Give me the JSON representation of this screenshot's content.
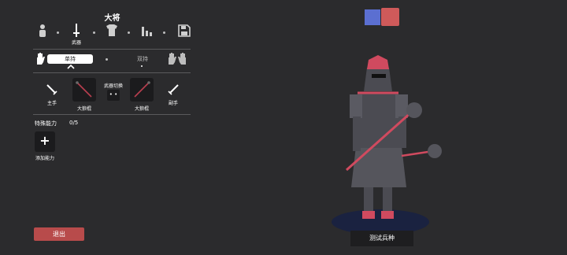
{
  "title": "大将",
  "categories": [
    {
      "label": "",
      "icon": "body-icon",
      "active": false
    },
    {
      "label": "武器",
      "icon": "sword-icon",
      "active": true
    },
    {
      "label": "",
      "icon": "armor-icon",
      "active": false
    },
    {
      "label": "",
      "icon": "stats-icon",
      "active": false
    },
    {
      "label": "",
      "icon": "save-icon",
      "active": false
    }
  ],
  "mode": {
    "single_label": "单持",
    "dual_label": "双持",
    "selected": "single"
  },
  "weapons": {
    "main_hand_label": "主手",
    "off_hand_label": "副手",
    "main_weapon_name": "大狼棍",
    "off_weapon_name": "大狼棍",
    "switch_label": "武器切换",
    "switch_value": "• •"
  },
  "abilities": {
    "label": "特殊能力",
    "count": "0/5",
    "add_symbol": "+",
    "add_label": "添加能力"
  },
  "exit_label": "退出",
  "test_unit_label": "测试兵种",
  "team_colors": [
    "#5b6fd1",
    "#cf5a5a"
  ],
  "colors": {
    "background": "#2b2b2d",
    "exit": "#b84b4b",
    "armor": "#4b4b52",
    "trim": "#d04a5f",
    "base": "#1a2240"
  }
}
